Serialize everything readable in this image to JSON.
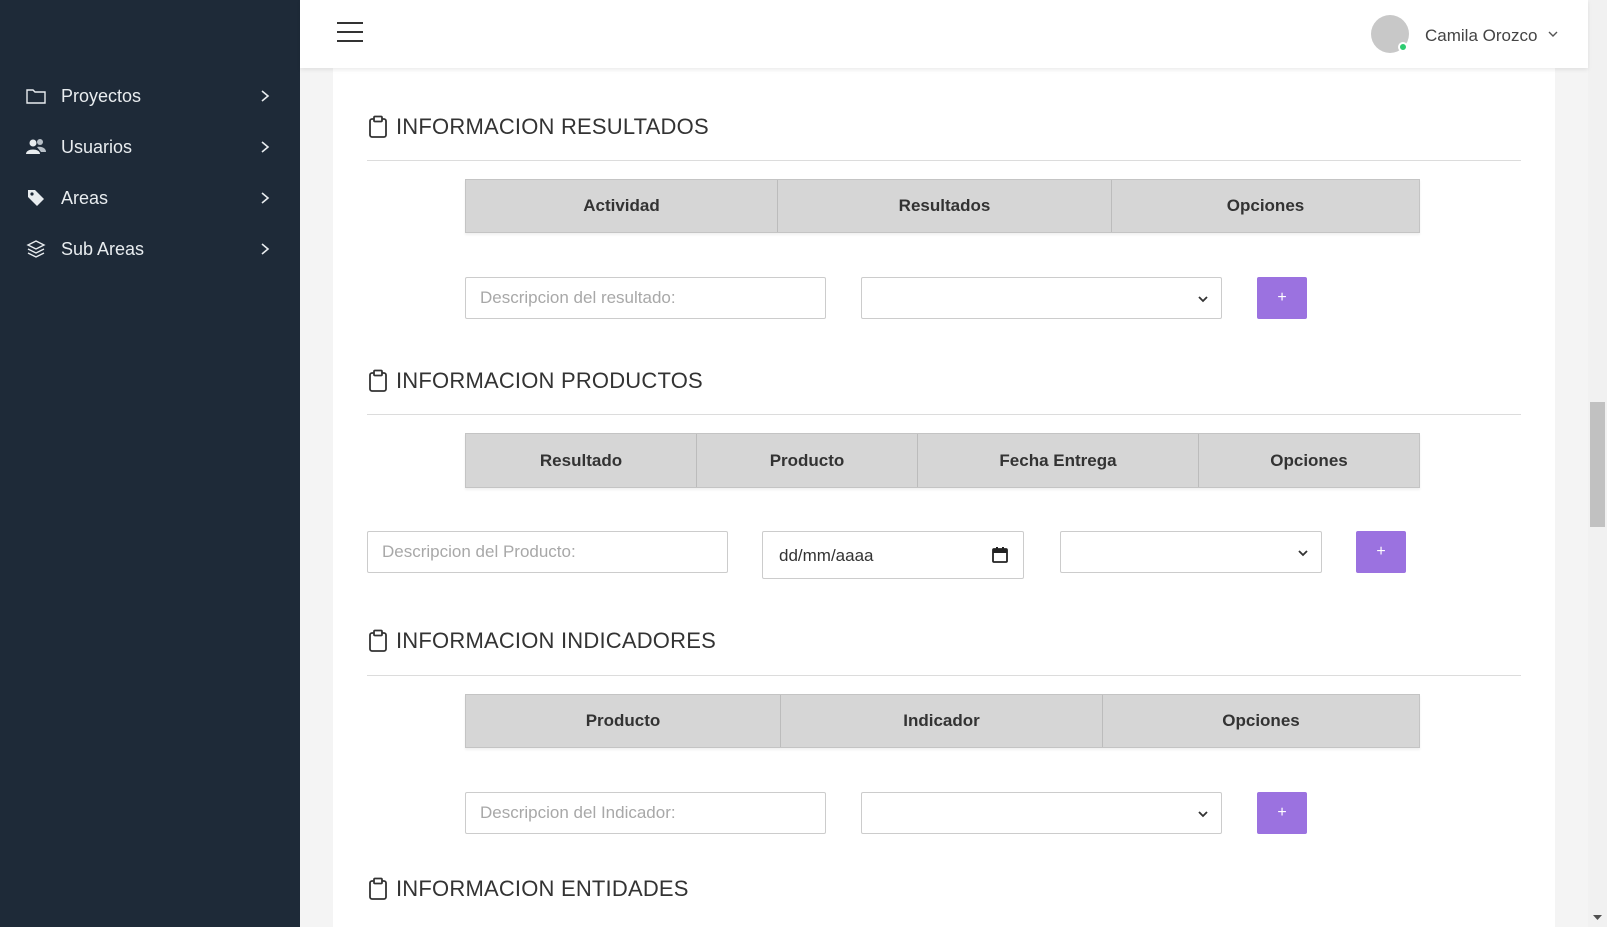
{
  "sidebar": {
    "items": [
      {
        "label": "Proyectos",
        "icon": "folder-icon"
      },
      {
        "label": "Usuarios",
        "icon": "users-icon"
      },
      {
        "label": "Areas",
        "icon": "tag-icon"
      },
      {
        "label": "Sub Areas",
        "icon": "layers-icon"
      }
    ]
  },
  "topbar": {
    "menu_icon": "hamburger-icon",
    "user_name": "Camila Orozco"
  },
  "sections": {
    "resultados": {
      "title": "INFORMACION RESULTADOS",
      "columns": [
        "Actividad",
        "Resultados",
        "Opciones"
      ],
      "input_placeholder": "Descripcion del resultado:",
      "select_value": "",
      "add_label": "+"
    },
    "productos": {
      "title": "INFORMACION PRODUCTOS",
      "columns": [
        "Resultado",
        "Producto",
        "Fecha Entrega",
        "Opciones"
      ],
      "input_placeholder": "Descripcion del Producto:",
      "date_value": "dd/mm/aaaa",
      "select_value": "",
      "add_label": "+"
    },
    "indicadores": {
      "title": "INFORMACION INDICADORES",
      "columns": [
        "Producto",
        "Indicador",
        "Opciones"
      ],
      "input_placeholder": "Descripcion del Indicador:",
      "select_value": "",
      "add_label": "+"
    },
    "entidades": {
      "title": "INFORMACION ENTIDADES"
    }
  },
  "colors": {
    "sidebar_bg": "#1e2a38",
    "button_accent": "#9b72e0",
    "table_header_bg": "#d6d6d6",
    "status_online": "#2ecc71"
  }
}
